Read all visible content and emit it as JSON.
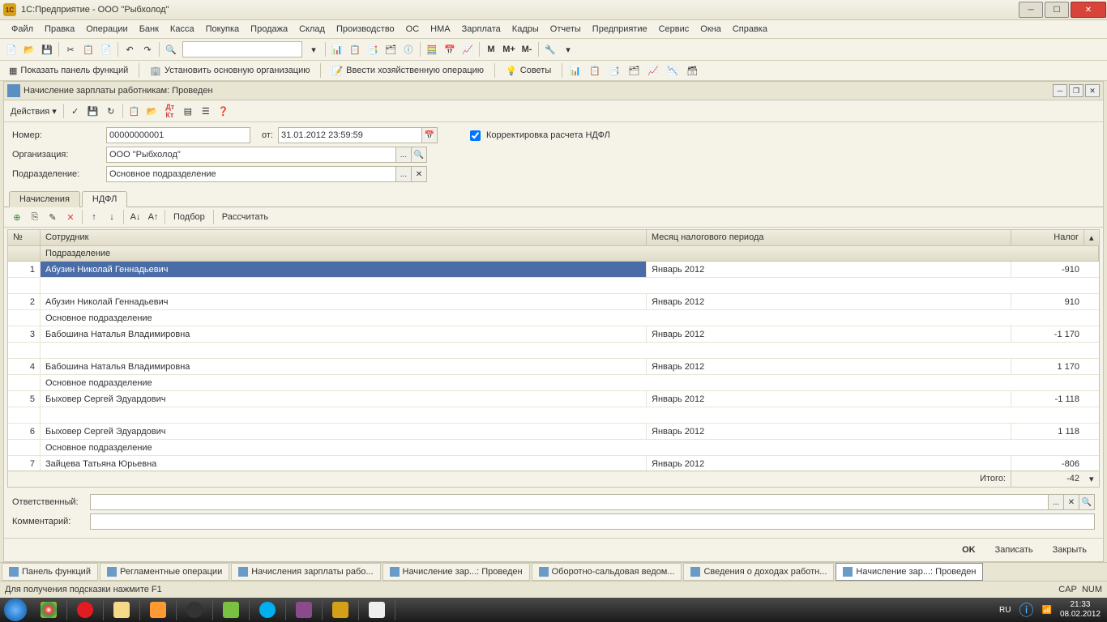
{
  "window": {
    "title": "1С:Предприятие - ООО \"Рыбхолод\""
  },
  "menu": [
    "Файл",
    "Правка",
    "Операции",
    "Банк",
    "Касса",
    "Покупка",
    "Продажа",
    "Склад",
    "Производство",
    "ОС",
    "НМА",
    "Зарплата",
    "Кадры",
    "Отчеты",
    "Предприятие",
    "Сервис",
    "Окна",
    "Справка"
  ],
  "toolbar2": {
    "show_panel": "Показать панель функций",
    "set_org": "Установить основную организацию",
    "enter_op": "Ввести хозяйственную операцию",
    "tips": "Советы"
  },
  "doc": {
    "title": "Начисление зарплаты работникам: Проведен",
    "actions": "Действия",
    "number_label": "Номер:",
    "number": "00000000001",
    "from_label": "от:",
    "date": "31.01.2012 23:59:59",
    "org_label": "Организация:",
    "org": "ООО \"Рыбхолод\"",
    "dep_label": "Подразделение:",
    "dep": "Основное подразделение",
    "correction_label": "Корректировка расчета НДФЛ",
    "tabs": {
      "accruals": "Начисления",
      "ndfl": "НДФЛ"
    },
    "tab_toolbar": {
      "select": "Подбор",
      "calc": "Рассчитать"
    },
    "grid": {
      "n": "№",
      "emp": "Сотрудник",
      "month": "Месяц налогового периода",
      "tax": "Налог",
      "dep": "Подразделение",
      "rows": [
        {
          "n": "1",
          "emp": "Абузин Николай Геннадьевич",
          "month": "Январь 2012",
          "tax": "-910",
          "dep": ""
        },
        {
          "n": "2",
          "emp": "Абузин Николай Геннадьевич",
          "month": "Январь 2012",
          "tax": "910",
          "dep": "Основное подразделение"
        },
        {
          "n": "3",
          "emp": "Бабошина Наталья Владимировна",
          "month": "Январь 2012",
          "tax": "-1 170",
          "dep": ""
        },
        {
          "n": "4",
          "emp": "Бабошина Наталья Владимировна",
          "month": "Январь 2012",
          "tax": "1 170",
          "dep": "Основное подразделение"
        },
        {
          "n": "5",
          "emp": "Быховер Сергей Эдуардович",
          "month": "Январь 2012",
          "tax": "-1 118",
          "dep": ""
        },
        {
          "n": "6",
          "emp": "Быховер Сергей Эдуардович",
          "month": "Январь 2012",
          "tax": "1 118",
          "dep": "Основное подразделение"
        },
        {
          "n": "7",
          "emp": "Зайцева Татьяна Юрьевна",
          "month": "Январь 2012",
          "tax": "-806",
          "dep": ""
        }
      ],
      "total_label": "Итого:",
      "total": "-42"
    },
    "resp_label": "Ответственный:",
    "comment_label": "Комментарий:",
    "buttons": {
      "ok": "OK",
      "write": "Записать",
      "close": "Закрыть"
    }
  },
  "tasks": [
    "Панель функций",
    "Регламентные операции",
    "Начисления зарплаты рабо...",
    "Начисление зар...: Проведен",
    "Оборотно-сальдовая ведом...",
    "Сведения о доходах работн...",
    "Начисление зар...: Проведен"
  ],
  "status": {
    "hint": "Для получения подсказки нажмите F1",
    "cap": "CAP",
    "num": "NUM"
  },
  "tray": {
    "lang": "RU",
    "time": "21:33",
    "date": "08.02.2012"
  }
}
